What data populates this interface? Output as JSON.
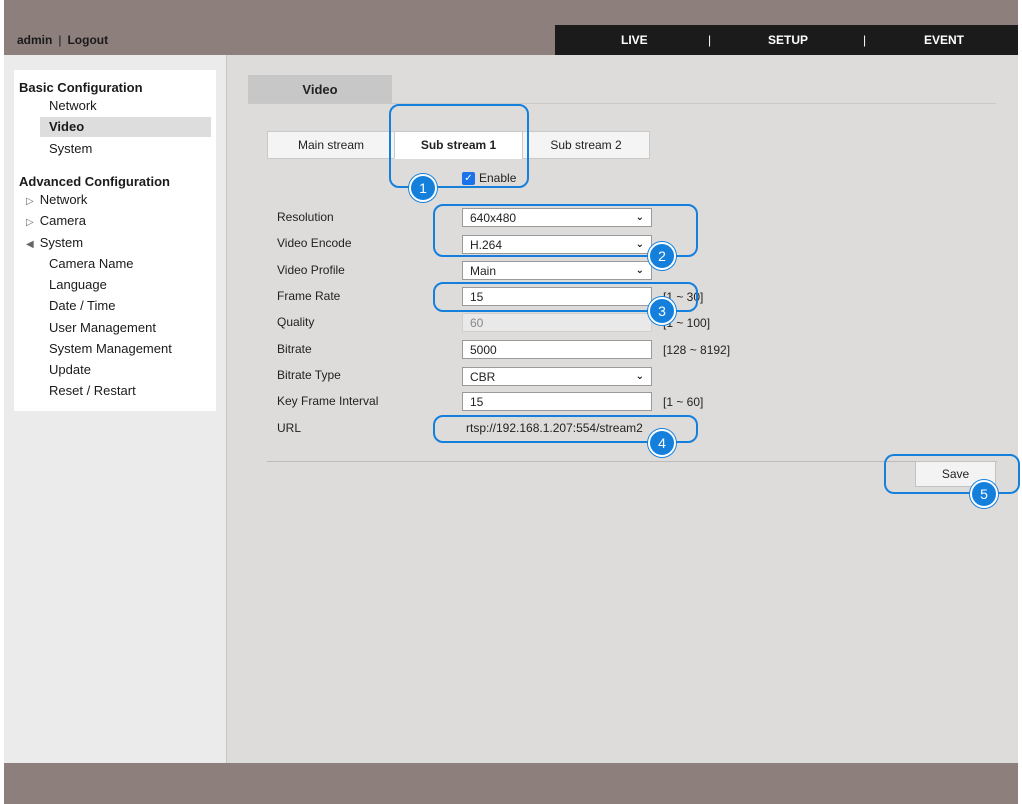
{
  "header": {
    "user": "admin",
    "separator": "|",
    "logout": "Logout",
    "nav": [
      "LIVE",
      "SETUP",
      "EVENT"
    ],
    "nav_separator": "|"
  },
  "sidebar": {
    "basic_title": "Basic Configuration",
    "basic_items": [
      "Network",
      "Video",
      "System"
    ],
    "advanced_title": "Advanced Configuration",
    "advanced_items": [
      "Network",
      "Camera",
      "System"
    ],
    "system_children": [
      "Camera Name",
      "Language",
      "Date / Time",
      "User Management",
      "System Management",
      "Update",
      "Reset / Restart"
    ]
  },
  "page": {
    "tab": "Video",
    "subtabs": [
      "Main stream",
      "Sub stream 1",
      "Sub stream 2"
    ],
    "enable_label": "Enable",
    "enable_checked": true
  },
  "form": {
    "resolution": {
      "label": "Resolution",
      "value": "640x480"
    },
    "video_encode": {
      "label": "Video Encode",
      "value": "H.264"
    },
    "video_profile": {
      "label": "Video Profile",
      "value": "Main"
    },
    "frame_rate": {
      "label": "Frame Rate",
      "value": "15",
      "range": "[1 ~ 30]"
    },
    "quality": {
      "label": "Quality",
      "value": "60",
      "range": "[1 ~ 100]"
    },
    "bitrate": {
      "label": "Bitrate",
      "value": "5000",
      "range": "[128 ~ 8192]"
    },
    "bitrate_type": {
      "label": "Bitrate Type",
      "value": "CBR"
    },
    "key_frame_interval": {
      "label": "Key Frame Interval",
      "value": "15",
      "range": "[1 ~ 60]"
    },
    "url": {
      "label": "URL",
      "value": "rtsp://192.168.1.207:554/stream2"
    }
  },
  "save_label": "Save",
  "callouts": [
    "1",
    "2",
    "3",
    "4",
    "5"
  ],
  "colors": {
    "callout": "#1580dc",
    "header": "#8c7f7c",
    "topnav": "#1b1b1b"
  }
}
